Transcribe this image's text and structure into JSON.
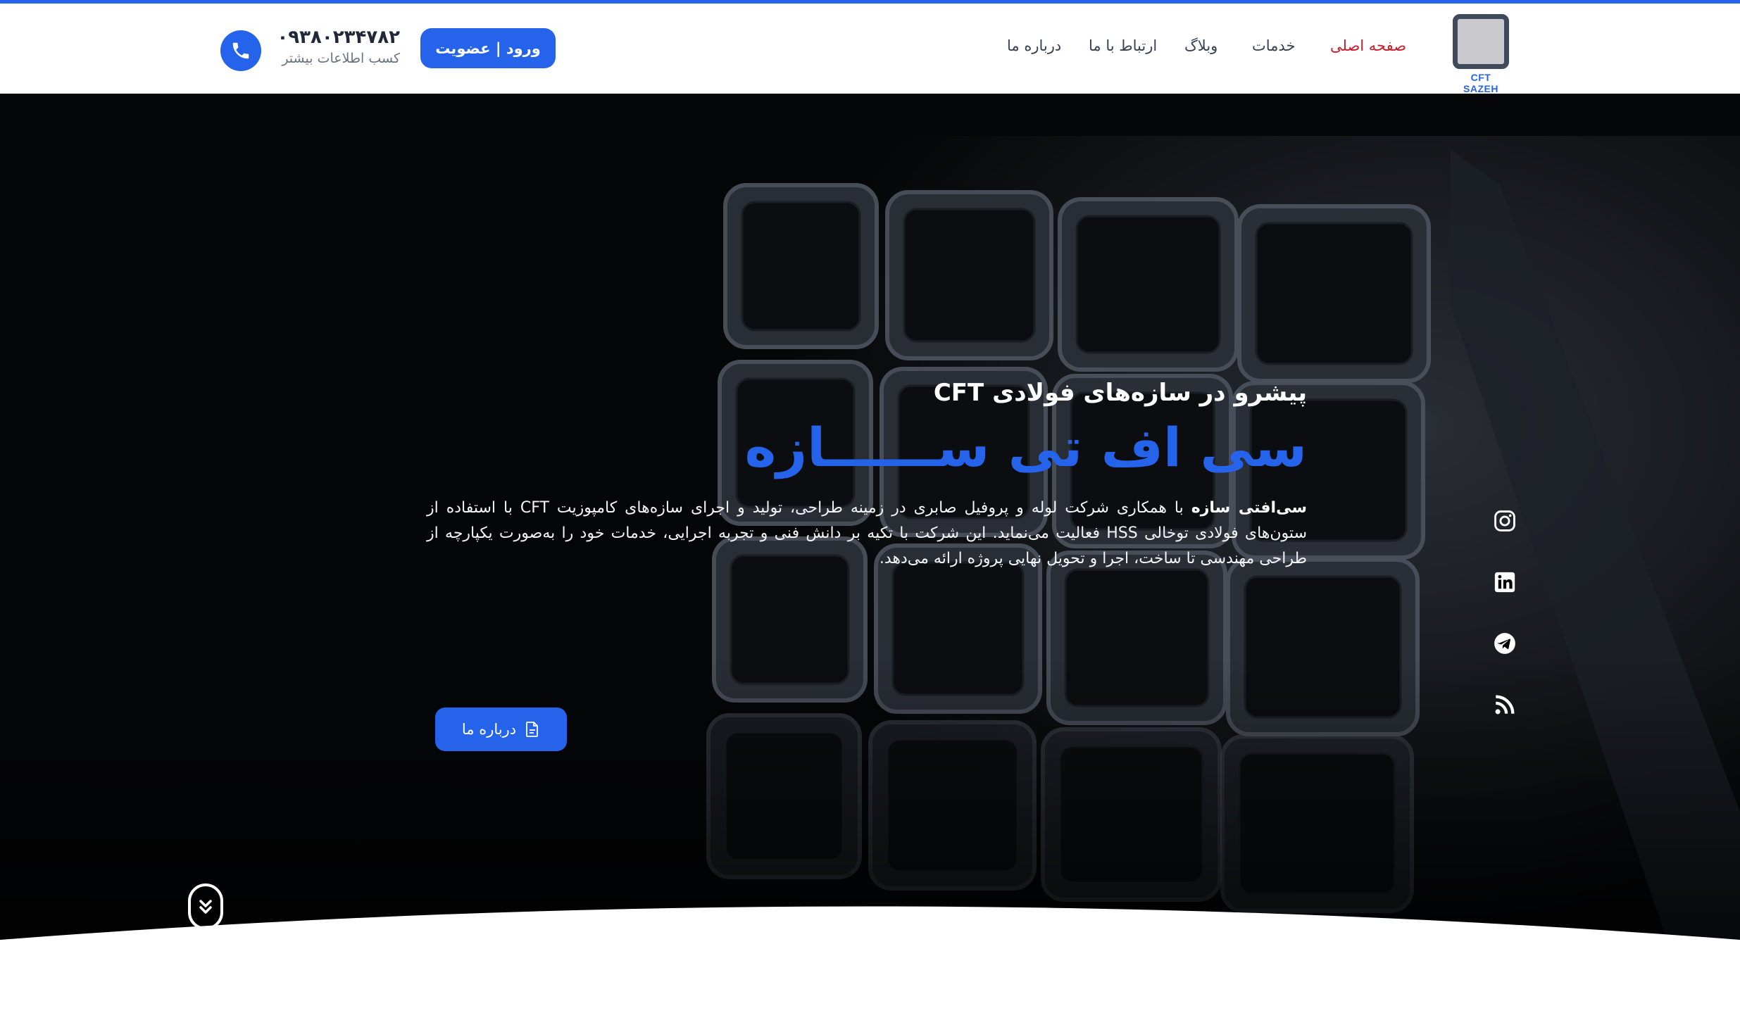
{
  "brand": {
    "logo_text": "CFT SAZEH",
    "accent_color": "#2563eb",
    "active_nav_color": "#c81d2d"
  },
  "nav": {
    "items": [
      {
        "label": "صفحه اصلی",
        "active": true
      },
      {
        "label": "خدمات",
        "active": false
      },
      {
        "label": "وبلاگ",
        "active": false
      },
      {
        "label": "ارتباط با ما",
        "active": false
      },
      {
        "label": "درباره ما",
        "active": false
      }
    ]
  },
  "header": {
    "login_label": "ورود | عضویت",
    "phone_number": "۰۹۳۸۰۲۳۴۷۸۲",
    "phone_sub": "کسب اطلاعات بیشتر",
    "phone_icon": "phone-icon"
  },
  "hero": {
    "subtitle": "پیشرو در سازه‌های فولادی CFT",
    "title": "سی اف تی ســــــازه",
    "desc_bold": "سی‌افتی سازه",
    "desc_rest": " با همکاری شرکت لوله و پروفیل صابری در زمینه طراحی، تولید و اجرای سازه‌های کامپوزیت CFT با استفاده از ستون‌های فولادی توخالی HSS فعالیت می‌نماید. این شرکت با تکیه بر دانش فنی و تجربه اجرایی، خدمات خود را به‌صورت یکپارچه از طراحی مهندسی تا ساخت، اجرا و تحویل نهایی پروژه ارائه می‌دهد.",
    "about_button": "درباره ما",
    "socials": [
      "instagram-icon",
      "linkedin-icon",
      "telegram-icon",
      "rss-icon"
    ],
    "scroll_icon": "chevrons-down-icon"
  }
}
